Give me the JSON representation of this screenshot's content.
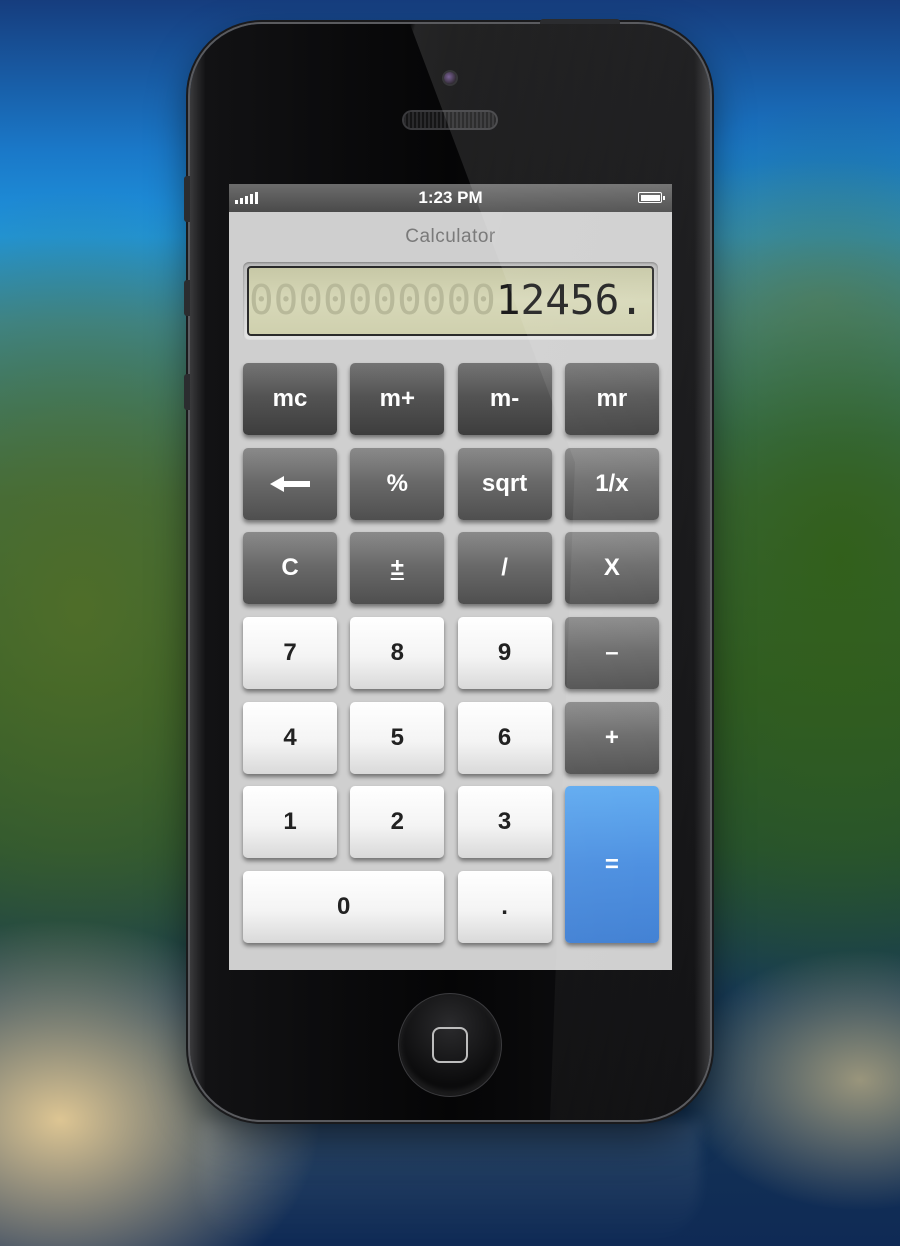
{
  "status_bar": {
    "time": "1:23 PM",
    "signal_icon": "cellular-signal-icon",
    "battery_icon": "battery-full-icon"
  },
  "app": {
    "title": "Calculator"
  },
  "display": {
    "ghost_digits": "0000000000",
    "value": "12456."
  },
  "keys": {
    "mc": "mc",
    "m_plus": "m+",
    "m_minus": "m-",
    "mr": "mr",
    "backspace_icon": "left-arrow-icon",
    "percent": "%",
    "sqrt": "sqrt",
    "reciprocal": "1/x",
    "clear": "C",
    "plus_minus": "±",
    "divide": "/",
    "multiply": "X",
    "seven": "7",
    "eight": "8",
    "nine": "9",
    "subtract": "–",
    "four": "4",
    "five": "5",
    "six": "6",
    "add": "+",
    "one": "1",
    "two": "2",
    "three": "3",
    "equals": "=",
    "zero": "0",
    "decimal": "."
  },
  "colors": {
    "equals_key": "#4a8ee0",
    "lcd_background": "#d0d1b0",
    "function_key": "#6a6a6a",
    "digit_key": "#f4f4f4"
  }
}
